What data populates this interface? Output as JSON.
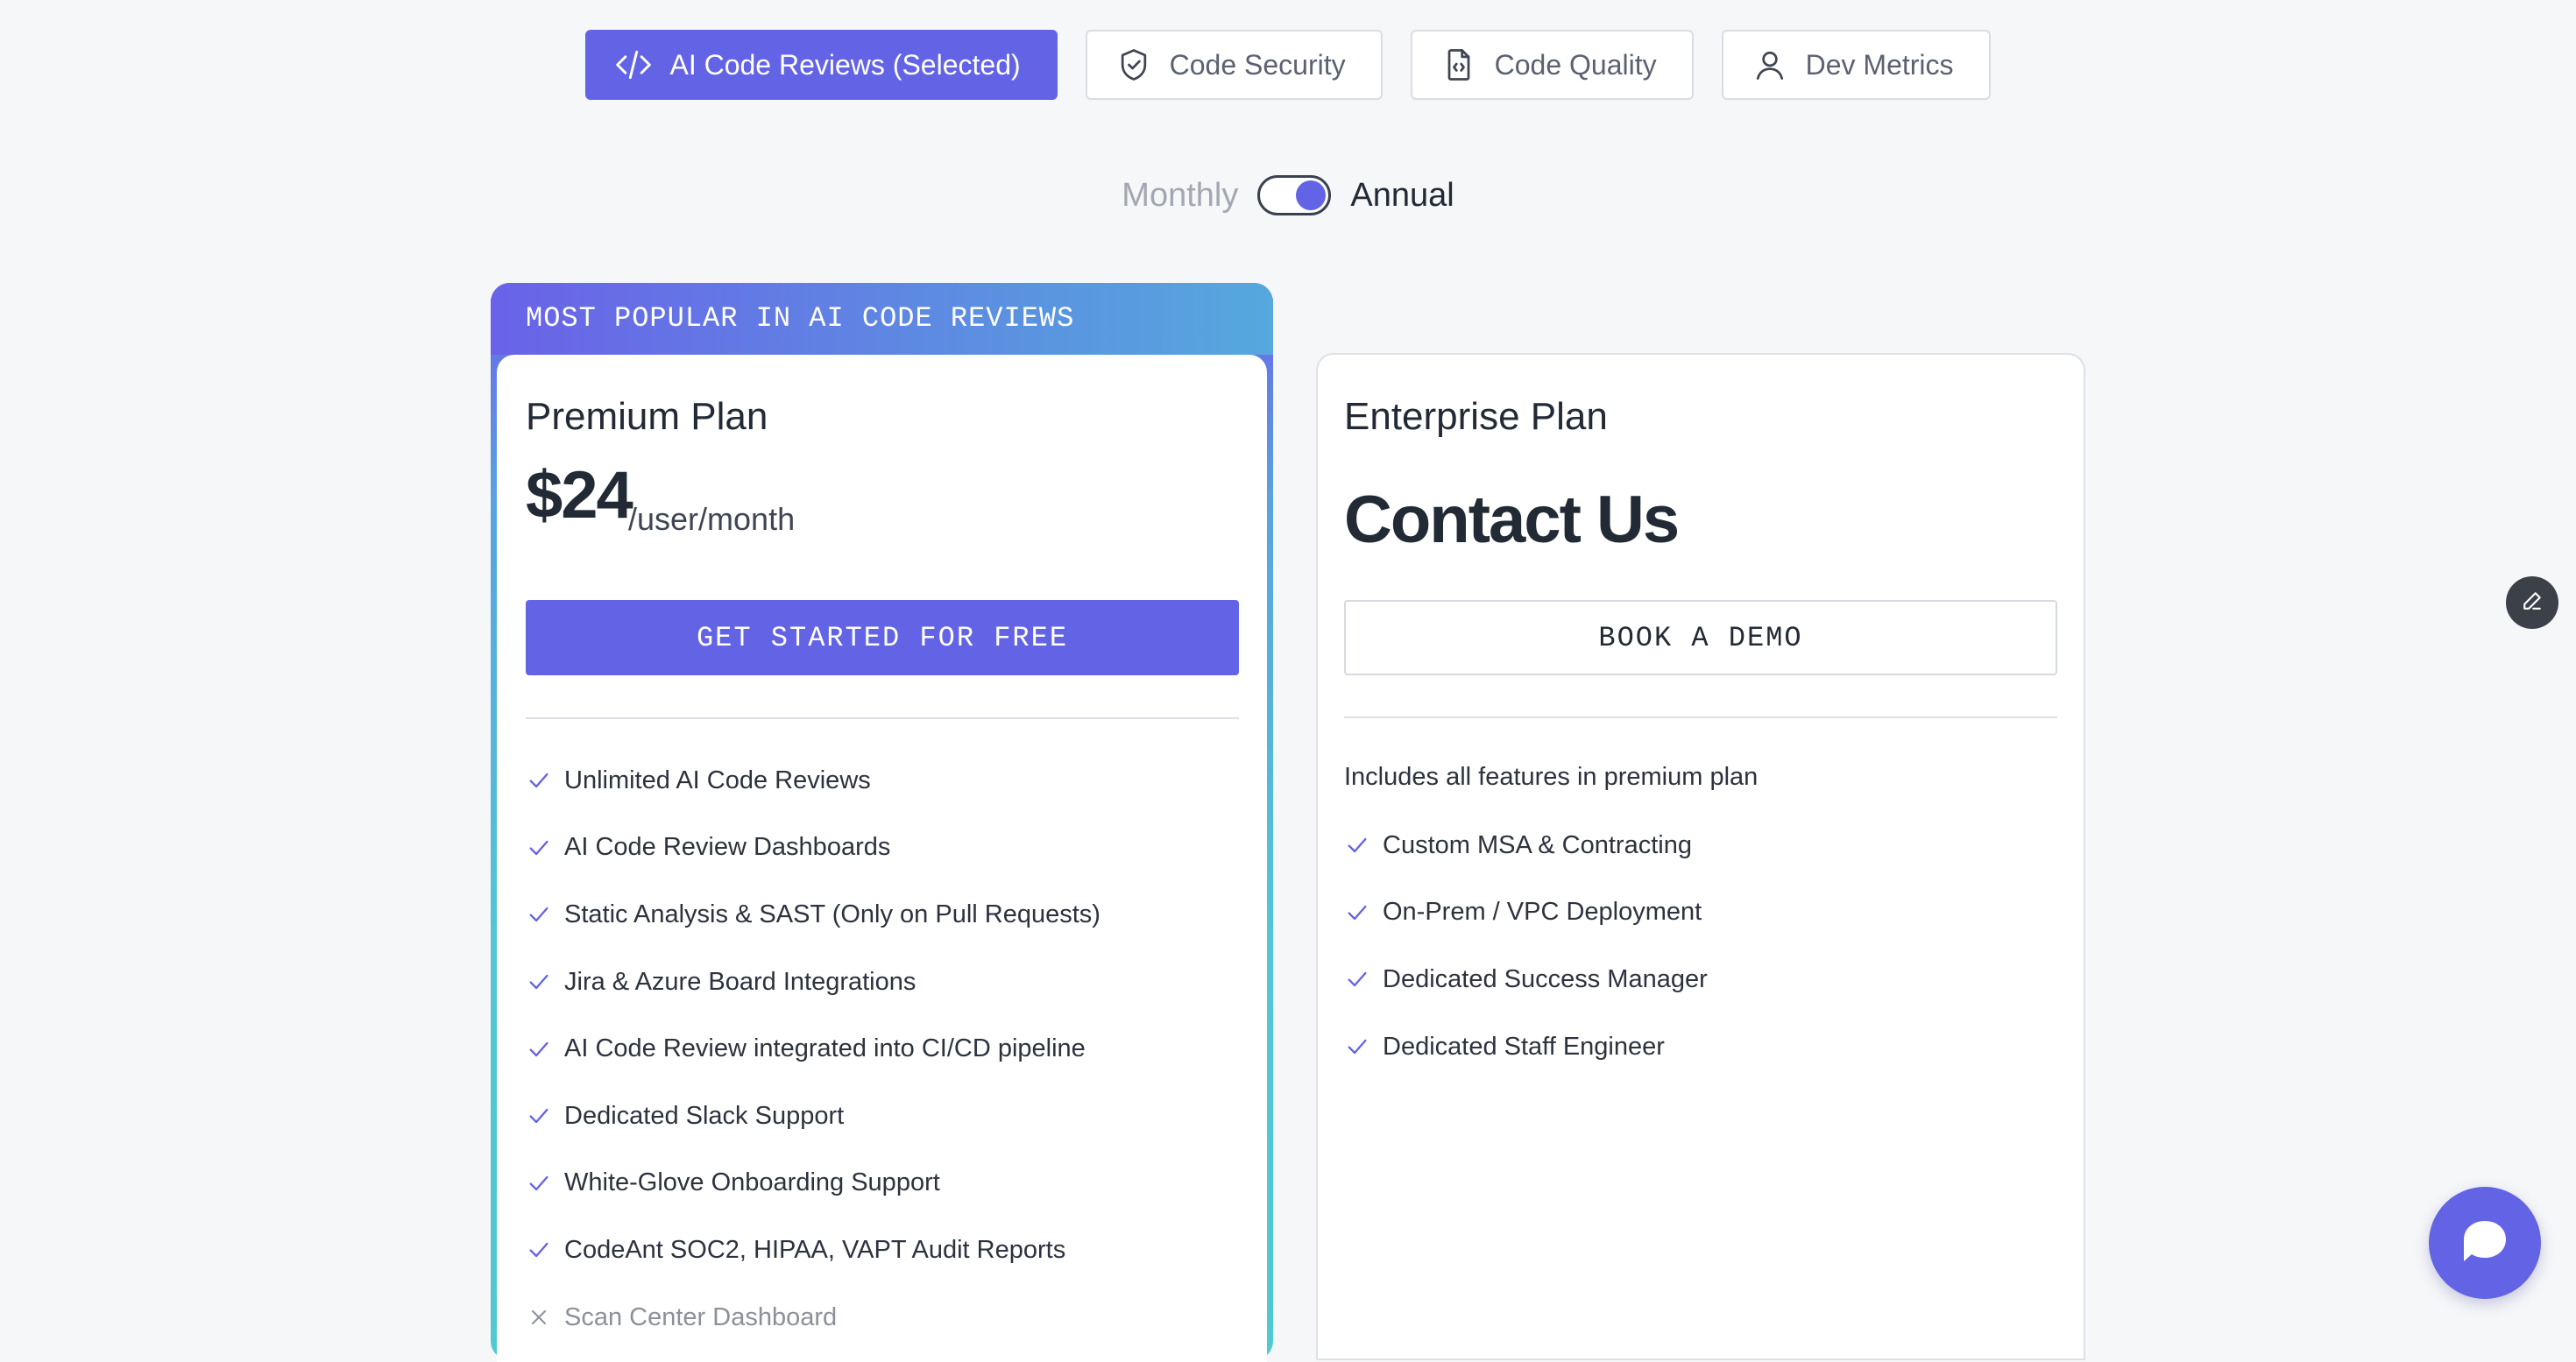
{
  "tabs": [
    {
      "label": "AI Code Reviews (Selected)",
      "icon": "code-icon",
      "selected": true
    },
    {
      "label": "Code Security",
      "icon": "shield-check-icon",
      "selected": false
    },
    {
      "label": "Code Quality",
      "icon": "code-file-icon",
      "selected": false
    },
    {
      "label": "Dev Metrics",
      "icon": "user-icon",
      "selected": false
    }
  ],
  "billing": {
    "monthly_label": "Monthly",
    "annual_label": "Annual",
    "selected": "Annual"
  },
  "premium": {
    "banner": "MOST POPULAR IN AI CODE REVIEWS",
    "title": "Premium Plan",
    "price": "$24",
    "price_unit": "/user/month",
    "cta": "GET STARTED FOR FREE",
    "features": [
      {
        "text": "Unlimited AI Code Reviews",
        "included": true
      },
      {
        "text": "AI Code Review Dashboards",
        "included": true
      },
      {
        "text": "Static Analysis & SAST (Only on Pull Requests)",
        "included": true
      },
      {
        "text": "Jira & Azure Board Integrations",
        "included": true
      },
      {
        "text": "AI Code Review integrated into CI/CD pipeline",
        "included": true
      },
      {
        "text": "Dedicated Slack Support",
        "included": true
      },
      {
        "text": "White-Glove Onboarding Support",
        "included": true
      },
      {
        "text": "CodeAnt SOC2, HIPAA, VAPT Audit Reports",
        "included": true
      },
      {
        "text": "Scan Center Dashboard",
        "included": false
      }
    ]
  },
  "enterprise": {
    "title": "Enterprise Plan",
    "price": "Contact Us",
    "cta": "BOOK A DEMO",
    "intro": "Includes all features in premium plan",
    "features": [
      {
        "text": "Custom MSA & Contracting",
        "included": true
      },
      {
        "text": "On-Prem / VPC Deployment",
        "included": true
      },
      {
        "text": "Dedicated Success Manager",
        "included": true
      },
      {
        "text": "Dedicated Staff Engineer",
        "included": true
      }
    ]
  },
  "colors": {
    "accent": "#6363e6",
    "text": "#222a35",
    "border": "#d9dce2",
    "background": "#f6f7f9"
  }
}
